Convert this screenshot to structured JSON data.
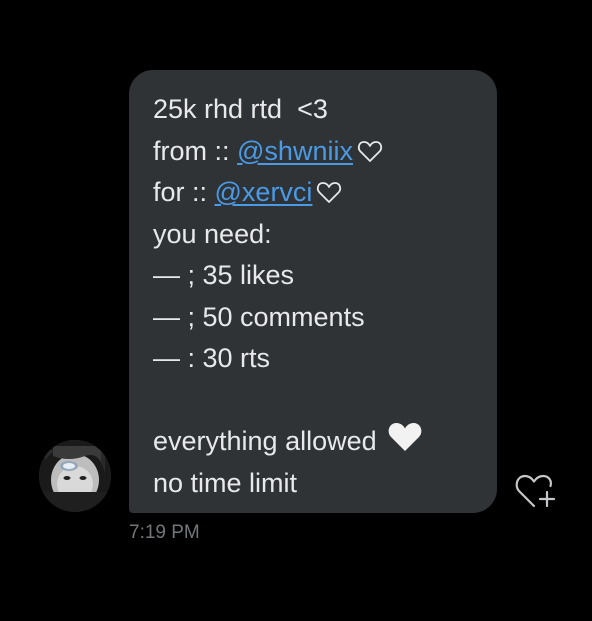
{
  "message": {
    "line1": "25k rhd rtd  <3",
    "line2_prefix": "from :: ",
    "line2_mention": "@shwniix",
    "line3_prefix": "for :: ",
    "line3_mention": "@xervci",
    "line4": "you need:",
    "line5": "— ; 35 likes",
    "line6": "— ; 50 comments",
    "line7": "— : 30 rts",
    "line8": "everything allowed",
    "line9": "no time limit",
    "heart_emoji": "🤍"
  },
  "timestamp": "7:19 PM",
  "colors": {
    "background": "#000000",
    "bubble": "#2f3336",
    "text": "#e7e9ea",
    "mention": "#4a9ae6",
    "timestamp": "#71767b"
  },
  "icons": {
    "outline_heart": "white-heart-outline-icon",
    "add_reaction": "heart-plus-icon"
  }
}
